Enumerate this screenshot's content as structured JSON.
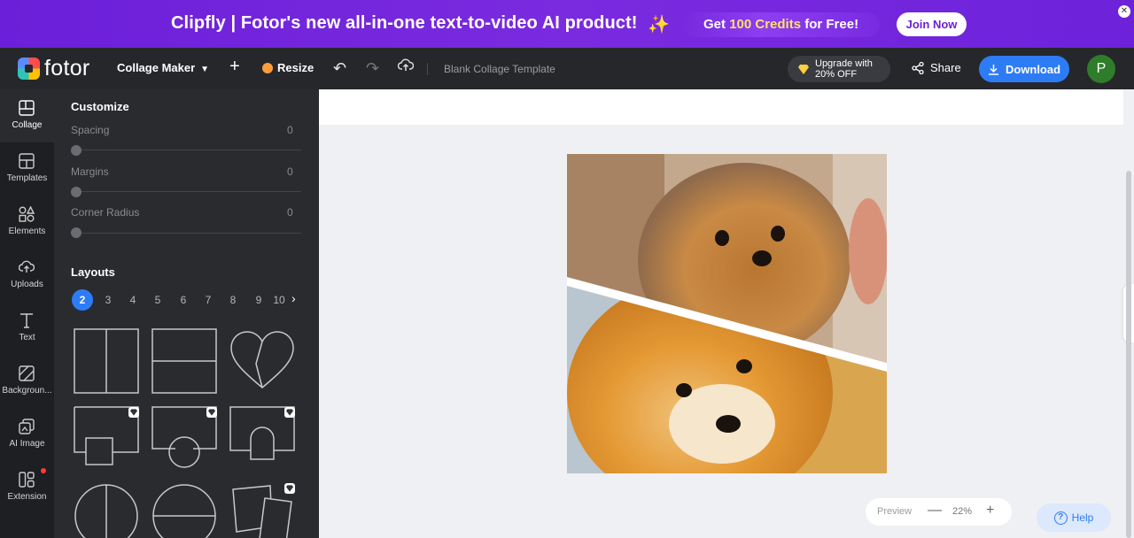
{
  "banner": {
    "title": "Clipfly | Fotor's new all-in-one text-to-video AI product!",
    "sparkle": "✨",
    "credits_pre": "Get ",
    "credits_num": "100 Credits",
    "credits_post": " for Free!",
    "join_label": "Join Now",
    "close": "✕"
  },
  "topbar": {
    "logo_text": "fotor",
    "collage_menu": "Collage Maker",
    "plus": "+",
    "resize_label": "Resize",
    "undo": "↶",
    "redo": "↷",
    "doc_title": "Blank Collage Template",
    "upgrade_line1": "Upgrade with",
    "upgrade_line2": "20% OFF",
    "share_label": "Share",
    "download_label": "Download",
    "avatar_letter": "P"
  },
  "rail": [
    {
      "label": "Collage",
      "icon": "collage-icon"
    },
    {
      "label": "Templates",
      "icon": "templates-icon"
    },
    {
      "label": "Elements",
      "icon": "elements-icon"
    },
    {
      "label": "Uploads",
      "icon": "uploads-icon"
    },
    {
      "label": "Text",
      "icon": "text-icon"
    },
    {
      "label": "Backgroun...",
      "icon": "background-icon"
    },
    {
      "label": "AI Image",
      "icon": "ai-image-icon"
    },
    {
      "label": "Extension",
      "icon": "extension-icon"
    }
  ],
  "panel": {
    "customize_title": "Customize",
    "settings": [
      {
        "label": "Spacing",
        "value": "0",
        "level": 0
      },
      {
        "label": "Margins",
        "value": "0",
        "level": 0
      },
      {
        "label": "Corner Radius",
        "value": "0",
        "level": 0
      }
    ],
    "layouts_title": "Layouts",
    "layout_numbers": [
      "2",
      "3",
      "4",
      "5",
      "6",
      "7",
      "8",
      "9",
      "10"
    ],
    "selected_layout": "2",
    "arrow": "›"
  },
  "canvas": {
    "zoom_preview": "Preview",
    "zoom_minus": "—",
    "zoom_value": "22%",
    "zoom_plus": "+",
    "help_label": "Help",
    "help_q": "?"
  },
  "colors": {
    "banner": "#6b1fd8",
    "accent": "#2d7cf6",
    "panel": "#2a2b2f",
    "rail": "#1e1f22",
    "avatar": "#2f7d2a"
  }
}
